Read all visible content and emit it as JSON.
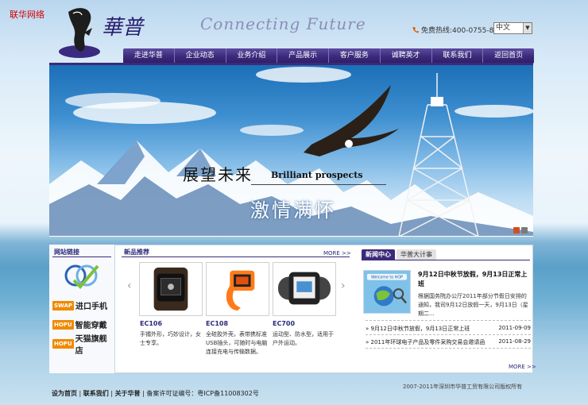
{
  "watermark": "联华网络",
  "slogan": "Connecting Future",
  "hotline": "免费热线:400-0755-848",
  "language": "中文",
  "nav": [
    "走进华普",
    "企业动态",
    "业务介绍",
    "产品展示",
    "客户服务",
    "诚聘英才",
    "联系我们",
    "返回首页"
  ],
  "banner": {
    "line1": "展望未来",
    "line2": "Brilliant prospects",
    "line3": "激情满怀"
  },
  "links": {
    "title": "网站链接",
    "brands": [
      {
        "tag": "SWAP",
        "text": "进口手机"
      },
      {
        "tag": "HOPU",
        "text": "智能穿戴"
      },
      {
        "tag": "HOPU",
        "text": "天猫旗舰店"
      }
    ]
  },
  "products": {
    "title": "新品推荐",
    "more": "MORE >>",
    "items": [
      {
        "name": "EC106",
        "desc": "手镯外形，巧妙设计，女士专享。"
      },
      {
        "name": "EC108",
        "desc": "全硅胶外壳，表带携标准USB插头，可随时与电脑连接充电与传输数据。"
      },
      {
        "name": "EC700",
        "desc": "运动型、防水型，适用于户外运动。"
      }
    ]
  },
  "news": {
    "tabs": [
      "新闻中心",
      "华普大计事"
    ],
    "headline": "9月12日中秋节放假，9月13日正常上班",
    "summary": "根据国务院办公厅2011年部分节假日安排的通知，我司9月12日放假一天，9月13日（星期二...",
    "items": [
      {
        "title": "» 9月12日中秋节放假，9月13日正常上班",
        "date": "2011-09-09"
      },
      {
        "title": "» 2011年环球电子产品及零件采购交易会邀请函",
        "date": "2011-08-29"
      }
    ],
    "more": "MORE >>"
  },
  "footer": {
    "links": [
      "设为首页",
      "联系我们",
      "关于华普"
    ],
    "icp": "备案许可证编号：粤ICP备11008302号",
    "copyright": "2007-2011年深圳市华普工贸有限公司版权所有"
  },
  "colors": {
    "nav": "#3b2a7a",
    "accent": "#f08a00",
    "watermark": "#d40000"
  }
}
